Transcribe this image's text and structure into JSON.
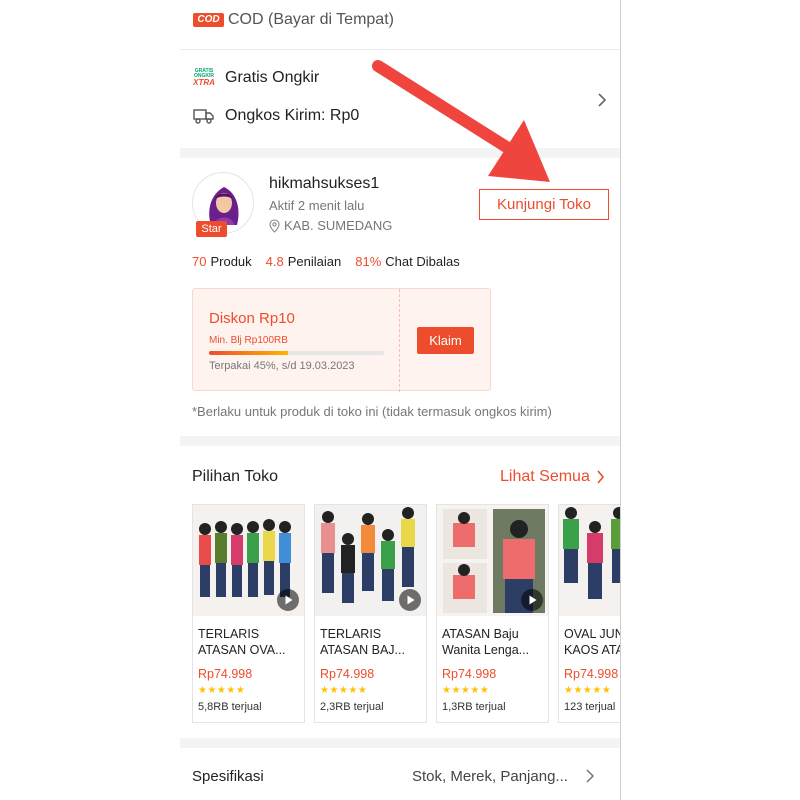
{
  "payment": {
    "cod_badge": "COD",
    "cod_text": "COD (Bayar di Tempat)"
  },
  "shipping": {
    "free_logo": {
      "line1": "GRATIS",
      "line2": "ONGKIR",
      "line3": "XTRA"
    },
    "free_label": "Gratis Ongkir",
    "cost_label": "Ongkos Kirim: Rp0"
  },
  "shop": {
    "name": "hikmahsukses1",
    "active": "Aktif 2 menit lalu",
    "location": "KAB. SUMEDANG",
    "badge": "Star",
    "visit_button": "Kunjungi Toko",
    "stats": [
      {
        "value": "70",
        "label": "Produk"
      },
      {
        "value": "4.8",
        "label": "Penilaian"
      },
      {
        "value": "81%",
        "label": "Chat Dibalas"
      }
    ]
  },
  "voucher": {
    "title": "Diskon Rp10",
    "min": "Min. Blj Rp100RB",
    "used_pct": 45,
    "used_text": "Terpakai 45%, s/d 19.03.2023",
    "claim": "Klaim"
  },
  "note": "*Berlaku untuk produk di toko ini (tidak termasuk ongkos kirim)",
  "picks": {
    "title": "Pilihan Toko",
    "see_all": "Lihat Semua",
    "products": [
      {
        "line1": "TERLARIS",
        "line2": "ATASAN OVA...",
        "price": "Rp74.998",
        "stars": "★★★★★",
        "sold": "5,8RB terjual"
      },
      {
        "line1": "TERLARIS",
        "line2": "ATASAN BAJ...",
        "price": "Rp74.998",
        "stars": "★★★★★",
        "sold": "2,3RB terjual"
      },
      {
        "line1": "ATASAN Baju",
        "line2": "Wanita Lenga...",
        "price": "Rp74.998",
        "stars": "★★★★★",
        "sold": "1,3RB terjual"
      },
      {
        "line1": "OVAL JUN",
        "line2": "KAOS ATA",
        "price": "Rp74.998",
        "stars": "★★★★★",
        "sold": "123 terjual"
      }
    ]
  },
  "specs": {
    "label": "Spesifikasi",
    "value": "Stok, Merek, Panjang..."
  },
  "colors": {
    "accent": "#ee4d2d",
    "arrow": "#f0453f",
    "voucher_bg": "#fff3ef"
  },
  "icons": [
    "cod-badge",
    "gratis-ongkir-xtra-logo",
    "truck-icon",
    "chevron-right-icon",
    "hijab-avatar",
    "location-pin-icon",
    "play-icon",
    "red-arrow-annotation"
  ]
}
